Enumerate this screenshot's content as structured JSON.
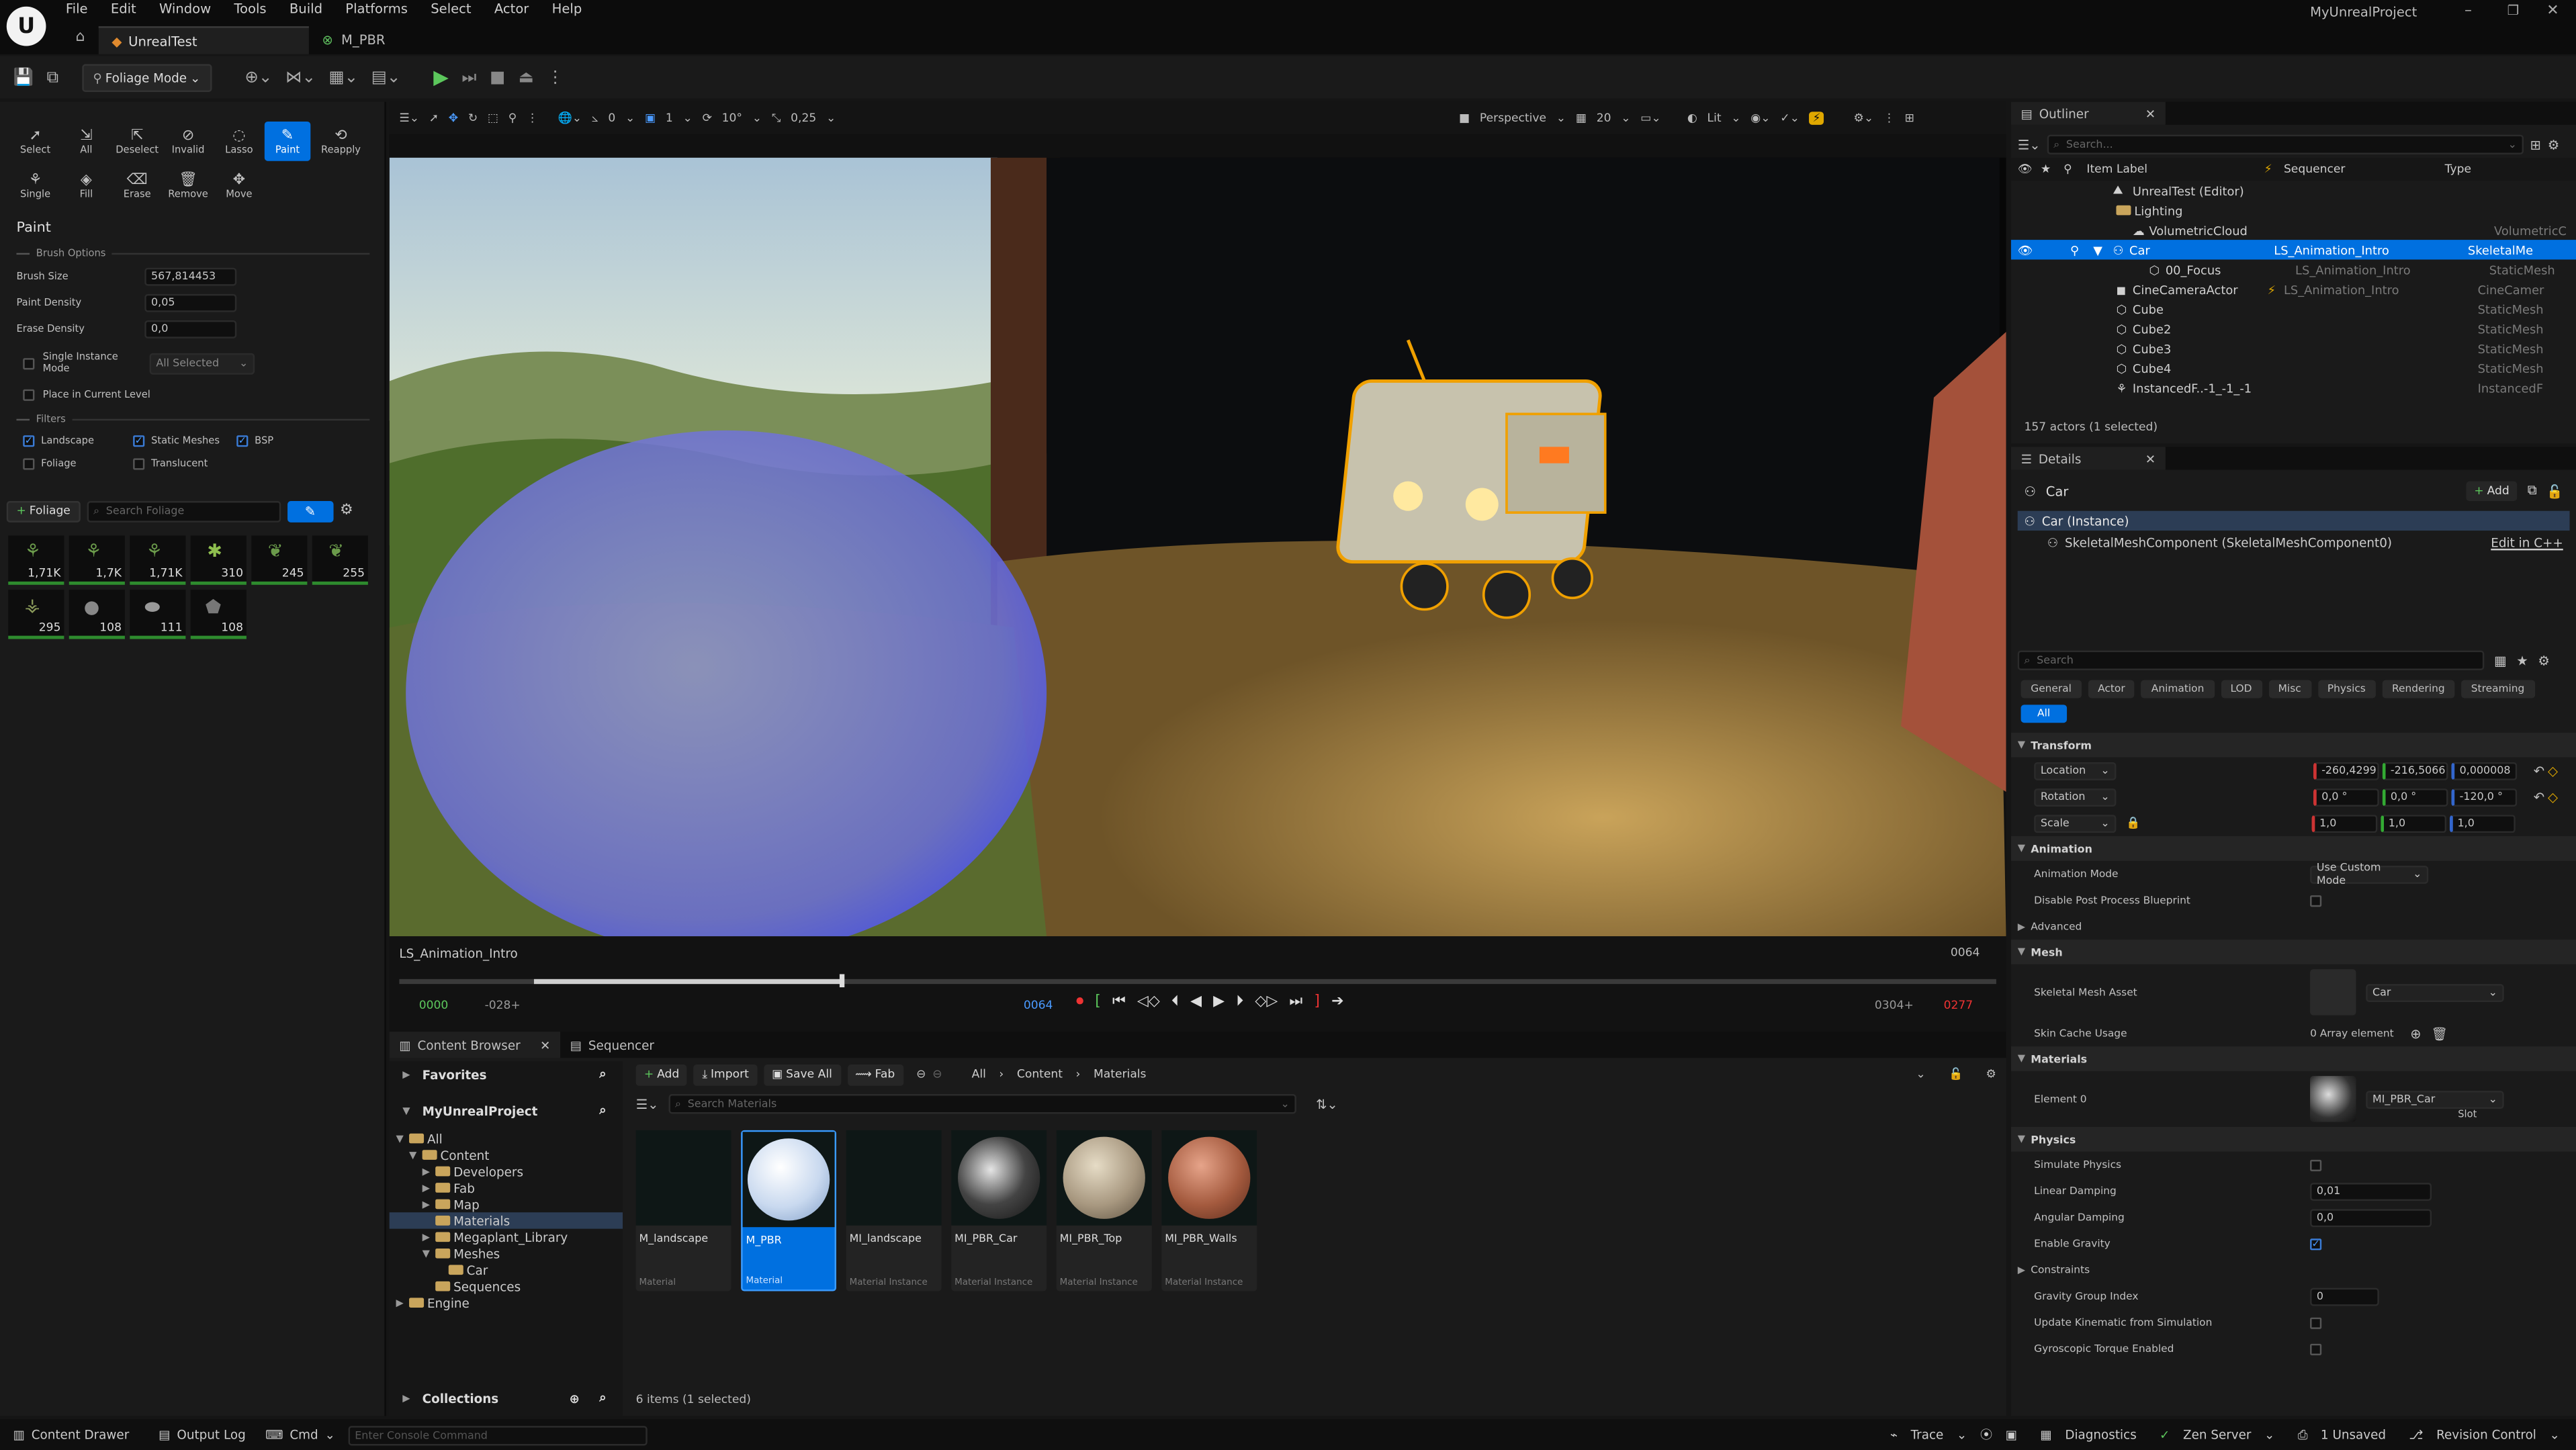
{
  "menu": [
    "File",
    "Edit",
    "Window",
    "Tools",
    "Build",
    "Platforms",
    "Select",
    "Actor",
    "Help"
  ],
  "project_name": "MyUnrealProject",
  "tabs": [
    {
      "label": "UnrealTest"
    },
    {
      "label": "M_PBR"
    }
  ],
  "toolbar": {
    "mode_label": "Foliage Mode"
  },
  "tools": {
    "row1": [
      "Select",
      "All",
      "Deselect",
      "Invalid",
      "Lasso",
      "Paint",
      "Reapply"
    ],
    "row2": [
      "Single",
      "Fill",
      "Erase",
      "Remove",
      "Move"
    ]
  },
  "paint": {
    "title": "Paint",
    "brush_options": "Brush Options",
    "brush_size_label": "Brush Size",
    "brush_size": "567,814453",
    "paint_density_label": "Paint Density",
    "paint_density": "0,05",
    "erase_density_label": "Erase Density",
    "erase_density": "0,0",
    "single_instance_label": "Single Instance Mode",
    "single_instance_value": "All Selected",
    "place_current_label": "Place in Current Level",
    "filters_label": "Filters",
    "filters": [
      "Landscape",
      "Static Meshes",
      "BSP",
      "Foliage",
      "Translucent"
    ]
  },
  "foliage": {
    "add_label": "Foliage",
    "search_placeholder": "Search Foliage",
    "counts": [
      "1,71K",
      "1,7K",
      "1,71K",
      "310",
      "245",
      "255",
      "295",
      "108",
      "111",
      "108"
    ]
  },
  "viewport": {
    "snap_angle": "0",
    "grid_count": "1",
    "rotation_snap": "10°",
    "scale_snap": "0,25",
    "view_mode": "Perspective",
    "fov": "20",
    "lighting": "Lit"
  },
  "sequencer": {
    "name": "LS_Animation_Intro",
    "frame": "0064",
    "start": "0000",
    "neg": "-028+",
    "current": "0064",
    "end_a": "0304+",
    "end_b": "0277"
  },
  "content_browser": {
    "tab_label": "Content Browser",
    "sequencer_tab": "Sequencer",
    "favorites": "Favorites",
    "project": "MyUnrealProject",
    "add": "Add",
    "import": "Import",
    "save_all": "Save All",
    "fab": "Fab",
    "breadcrumb": [
      "All",
      "Content",
      "Materials"
    ],
    "search_placeholder": "Search Materials",
    "tree": [
      "All",
      "Content",
      "Developers",
      "Fab",
      "Map",
      "Materials",
      "Megaplant_Library",
      "Meshes",
      "Car",
      "Sequences",
      "Engine"
    ],
    "collections": "Collections",
    "status": "6 items (1 selected)",
    "assets": [
      {
        "name": "M_landscape",
        "type": "Material"
      },
      {
        "name": "M_PBR",
        "type": "Material"
      },
      {
        "name": "MI_landscape",
        "type": "Material Instance"
      },
      {
        "name": "MI_PBR_Car",
        "type": "Material Instance"
      },
      {
        "name": "MI_PBR_Top",
        "type": "Material Instance"
      },
      {
        "name": "MI_PBR_Walls",
        "type": "Material Instance"
      }
    ]
  },
  "outliner": {
    "title": "Outliner",
    "search_placeholder": "Search...",
    "col_label": "Item Label",
    "col_seq": "Sequencer",
    "col_type": "Type",
    "rows": [
      {
        "label": "UnrealTest (Editor)",
        "seq": "",
        "type": ""
      },
      {
        "label": "Lighting",
        "seq": "",
        "type": ""
      },
      {
        "label": "VolumetricCloud",
        "seq": "",
        "type": "VolumetricC"
      },
      {
        "label": "Car",
        "seq": "LS_Animation_Intro",
        "type": "SkeletalMe"
      },
      {
        "label": "00_Focus",
        "seq": "LS_Animation_Intro",
        "type": "StaticMesh"
      },
      {
        "label": "CineCameraActor",
        "seq": "LS_Animation_Intro",
        "type": "CineCamer"
      },
      {
        "label": "Cube",
        "seq": "",
        "type": "StaticMesh"
      },
      {
        "label": "Cube2",
        "seq": "",
        "type": "StaticMesh"
      },
      {
        "label": "Cube3",
        "seq": "",
        "type": "StaticMesh"
      },
      {
        "label": "Cube4",
        "seq": "",
        "type": "StaticMesh"
      },
      {
        "label": "InstancedF..-1_-1_-1",
        "seq": "",
        "type": "InstancedF"
      }
    ],
    "status": "157 actors (1 selected)"
  },
  "details": {
    "title": "Details",
    "actor": "Car",
    "add": "Add",
    "instance": "Car (Instance)",
    "component": "SkeletalMeshComponent (SkeletalMeshComponent0)",
    "edit_cpp": "Edit in C++",
    "search_placeholder": "Search",
    "cat_tabs": [
      "General",
      "Actor",
      "Animation",
      "LOD",
      "Misc",
      "Physics",
      "Rendering",
      "Streaming",
      "All"
    ],
    "transform": "Transform",
    "location": "Location",
    "loc": [
      "-260,4299",
      "-216,5066",
      "0,000008"
    ],
    "rotation": "Rotation",
    "rot": [
      "0,0 °",
      "0,0 °",
      "-120,0 °"
    ],
    "scale": "Scale",
    "scl": [
      "1,0",
      "1,0",
      "1,0"
    ],
    "animation": "Animation",
    "anim_mode_label": "Animation Mode",
    "anim_mode": "Use Custom Mode",
    "disable_pp": "Disable Post Process Blueprint",
    "advanced": "Advanced",
    "mesh": "Mesh",
    "skm_label": "Skeletal Mesh Asset",
    "skm_value": "Car",
    "skin_cache_label": "Skin Cache Usage",
    "skin_cache": "0 Array element",
    "materials": "Materials",
    "element0": "Element 0",
    "element0_value": "MI_PBR_Car",
    "slot": "Slot",
    "physics": "Physics",
    "sim_phys": "Simulate Physics",
    "lin_damp_label": "Linear Damping",
    "lin_damp": "0,01",
    "ang_damp_label": "Angular Damping",
    "ang_damp": "0,0",
    "gravity": "Enable Gravity",
    "constraints": "Constraints",
    "grav_group_label": "Gravity Group Index",
    "grav_group": "0",
    "upd_kin": "Update Kinematic from Simulation",
    "gyro": "Gyroscopic Torque Enabled"
  },
  "statusbar": {
    "content_drawer": "Content Drawer",
    "output_log": "Output Log",
    "cmd": "Cmd",
    "console_placeholder": "Enter Console Command",
    "trace": "Trace",
    "diagnostics": "Diagnostics",
    "zen": "Zen Server",
    "unsaved": "1 Unsaved",
    "revision": "Revision Control"
  },
  "colors": {
    "accent": "#0070e0",
    "panel": "#1a1a1a",
    "header": "#0f0f0f"
  }
}
